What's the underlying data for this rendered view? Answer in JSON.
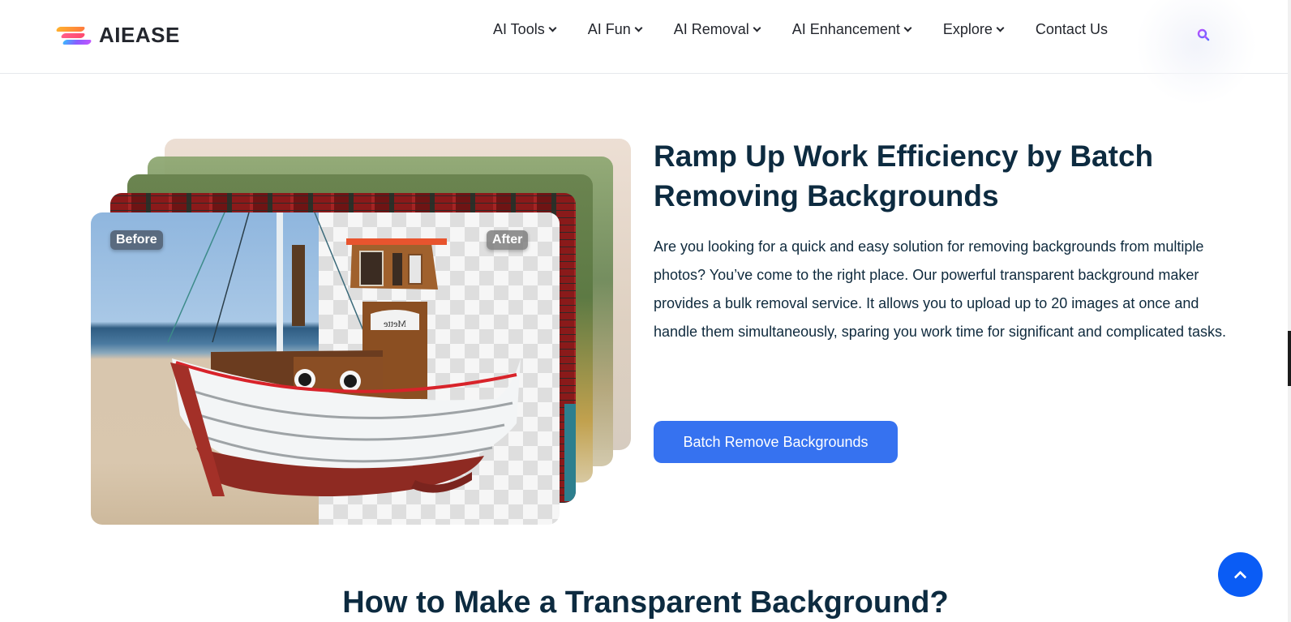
{
  "header": {
    "logo_text": "AIEASE",
    "nav": [
      {
        "label": "AI Tools",
        "has_dropdown": true
      },
      {
        "label": "AI Fun",
        "has_dropdown": true
      },
      {
        "label": "AI Removal",
        "has_dropdown": true
      },
      {
        "label": "AI Enhancement",
        "has_dropdown": true
      },
      {
        "label": "Explore",
        "has_dropdown": true
      },
      {
        "label": "Contact Us",
        "has_dropdown": false
      }
    ],
    "search_icon": "search-icon"
  },
  "hero": {
    "badge_before": "Before",
    "badge_after": "After",
    "boat_name": "Mette",
    "title": "Ramp Up Work Efficiency by Batch Removing Backgrounds",
    "description": "Are you looking for a quick and easy solution for removing backgrounds from multiple photos? You’ve come to the right place. Our powerful transparent background maker provides a bulk removal service. It allows you to upload up to 20 images at once and handle them simultaneously, sparing you work time for significant and complicated tasks.",
    "cta_label": "Batch Remove Backgrounds"
  },
  "next_section": {
    "title": "How to Make a Transparent Background?"
  },
  "colors": {
    "primary": "#3672f0",
    "back_to_top": "#0a5cf5",
    "heading": "#0d2b40",
    "search_icon": "#9b4dff"
  },
  "back_to_top_icon": "chevron-up-icon"
}
